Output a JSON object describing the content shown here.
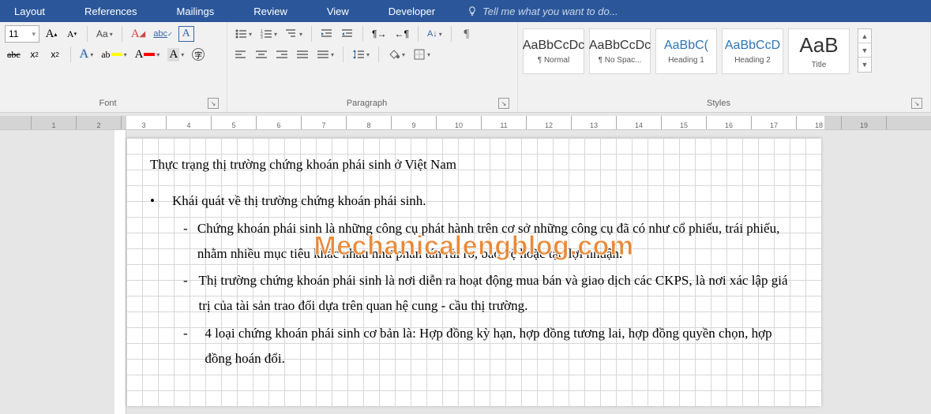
{
  "tabs": [
    "Layout",
    "References",
    "Mailings",
    "Review",
    "View",
    "Developer"
  ],
  "tellme": "Tell me what you want to do...",
  "font": {
    "size": "11",
    "grow": "A",
    "shrink": "A",
    "case": "Aa",
    "clear": "A",
    "groupLabel": "Font"
  },
  "para": {
    "groupLabel": "Paragraph"
  },
  "styles": {
    "items": [
      {
        "preview": "AaBbCcDc",
        "name": "¶ Normal",
        "cls": ""
      },
      {
        "preview": "AaBbCcDc",
        "name": "¶ No Spac...",
        "cls": ""
      },
      {
        "preview": "AaBbC(",
        "name": "Heading 1",
        "cls": "heading-prev"
      },
      {
        "preview": "AaBbCcD",
        "name": "Heading 2",
        "cls": "heading-prev"
      },
      {
        "preview": "AaB",
        "name": "Title",
        "cls": "title-prev"
      }
    ],
    "groupLabel": "Styles"
  },
  "doc": {
    "title": "Thực trạng thị trường chứng khoán phái sinh ở Việt Nam",
    "bullet1": "Khái quát về thị trường chứng khoán phái sinh.",
    "d1": "Chứng khoán phái sinh là những công cụ phát hành trên cơ sở những công cụ đã có như cổ phiếu, trái phiếu, nhằm nhiều mục tiêu khác nhau như phân tán rủi ro, bảo vệ hoặc tạo lợi nhuận.",
    "d2": "Thị trường chứng khoán phái sinh là nơi diễn ra hoạt động mua bán và giao dịch các CKPS, là nơi xác lập giá trị của tài sản trao đổi dựa trên quan hệ cung - cầu thị trường.",
    "d3": "4 loại chứng khoán phái sinh cơ bản là: Hợp đồng kỳ hạn, hợp đồng tương lai, hợp đồng quyền chọn, hợp đồng hoán đổi."
  },
  "watermark": "Mechanicalengblog.com",
  "ruler": [
    "1",
    "2",
    "3",
    "4",
    "5",
    "6",
    "7",
    "8",
    "9",
    "10",
    "11",
    "12",
    "13",
    "14",
    "15",
    "16",
    "17",
    "18",
    "19"
  ]
}
